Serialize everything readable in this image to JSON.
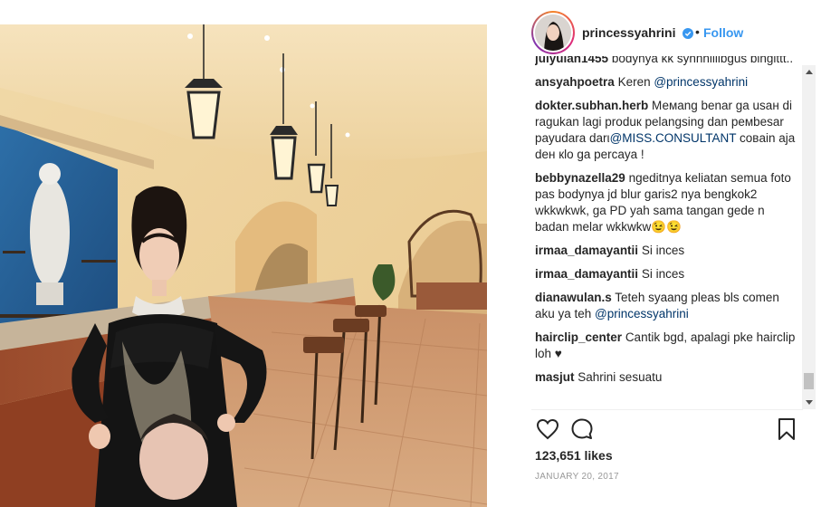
{
  "post": {
    "username": "princessyahrini",
    "follow_label": "Follow",
    "separator": "•",
    "likes": "123,651 likes",
    "date": "JANUARY 20, 2017"
  },
  "comments": [
    {
      "user": "julyulan1455",
      "text": "bodynya kk syhhhiiiibgus bingittt.."
    },
    {
      "user": "ansyahpoetra",
      "text": "Keren ",
      "mention": "@princessyahrini"
    },
    {
      "user": "dokter.subhan.herb",
      "text": "Мемang benar ga usaн di ragukan lagi produк pelangsing dan pемbesar payudara darι",
      "mention": "@MISS.CONSULTANT",
      "text2": " coвain aja deн кlo ga percaya !"
    },
    {
      "user": "bebbynazella29",
      "text": "ngeditnya keliatan semua foto pas bodynya jd blur garis2 nya bengkok2 wkkwkwk, ga PD yah sama tangan gede n badan melar wkkwkw😉😉"
    },
    {
      "user": "irmaa_damayantii",
      "text": "Si inces"
    },
    {
      "user": "irmaa_damayantii",
      "text": "Si inces"
    },
    {
      "user": "dianawulan.s",
      "text": "Teteh syaang pleas bls comen aku ya teh ",
      "mention": "@princessyahrini"
    },
    {
      "user": "hairclip_center",
      "text": "Cantik bgd, apalagi pke hairclip loh ♥"
    },
    {
      "user": "masjut",
      "text": "Sahrini sesuatu"
    }
  ],
  "icons": {
    "verified": "verified-badge-icon",
    "like": "heart-icon",
    "comment": "comment-bubble-icon",
    "save": "bookmark-icon"
  },
  "colors": {
    "follow": "#3897f0",
    "verified": "#3897f0",
    "text": "#262626",
    "muted": "#999999"
  }
}
